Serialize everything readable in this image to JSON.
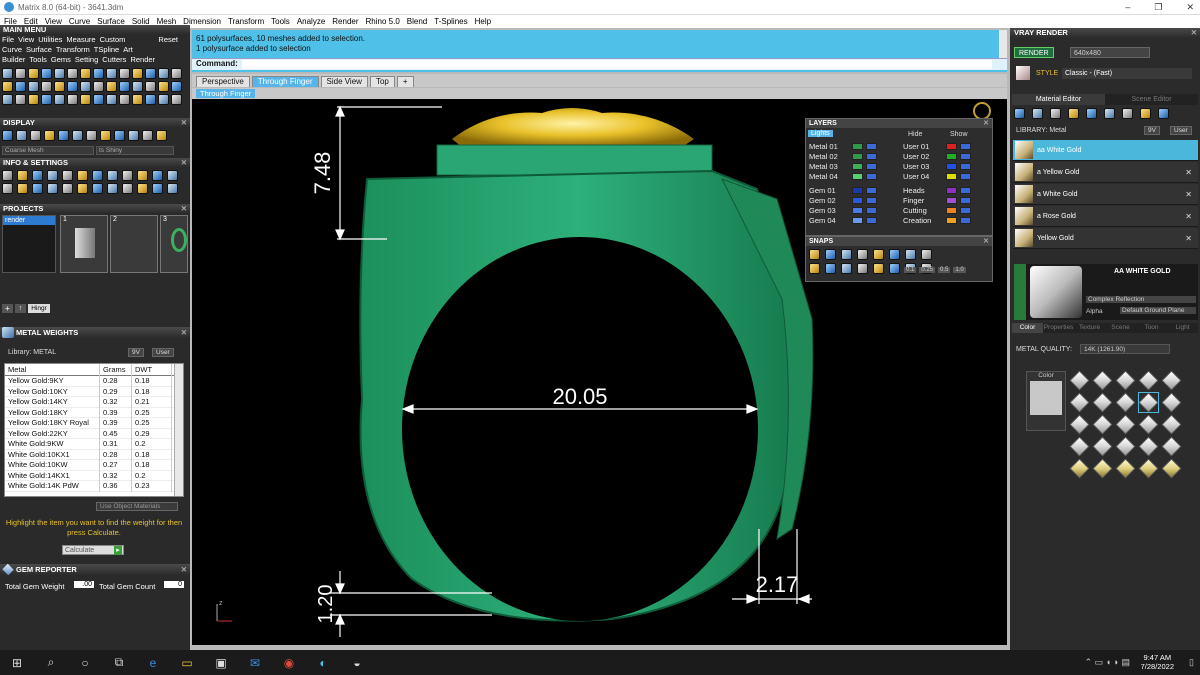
{
  "window": {
    "title": "Matrix 8.0 (64-bit) - 3641.3dm",
    "controls": [
      "–",
      "❐",
      "✕"
    ]
  },
  "menu": [
    "File",
    "Edit",
    "View",
    "Curve",
    "Surface",
    "Solid",
    "Mesh",
    "Dimension",
    "Transform",
    "Tools",
    "Analyze",
    "Render",
    "Rhino 5.0",
    "Blend",
    "T-Splines",
    "Help"
  ],
  "left": {
    "main_menu_title": "MAIN MENU",
    "main_menu_row1": [
      "File",
      "View",
      "Utilities",
      "Measure",
      "Custom"
    ],
    "reset": "Reset",
    "main_menu_row2": [
      "Curve",
      "Surface",
      "Transform",
      "TSpline",
      "Art"
    ],
    "main_menu_row3": [
      "Builder",
      "Tools",
      "Gems",
      "Setting",
      "Cutters",
      "Render"
    ],
    "display_title": "DISPLAY",
    "display_mesh": "Coarse Mesh",
    "display_shiny": "ts Shiny",
    "info_title": "INFO & SETTINGS",
    "projects_title": "PROJECTS",
    "projects_name": "render",
    "thumb_nums": [
      "1",
      "2",
      "3"
    ],
    "hinge": "Hingr",
    "metal_title": "METAL WEIGHTS",
    "library_label": "Library: METAL",
    "lib_opts": [
      "9V",
      "User"
    ],
    "table_headers": [
      "Metal",
      "Grams",
      "DWT"
    ],
    "metals": [
      [
        "Yellow Gold:9KY",
        "0.28",
        "0.18"
      ],
      [
        "Yellow Gold:10KY",
        "0.29",
        "0.18"
      ],
      [
        "Yellow Gold:14KY",
        "0.32",
        "0.21"
      ],
      [
        "Yellow Gold:18KY",
        "0.39",
        "0.25"
      ],
      [
        "Yellow Gold:18KY Royal",
        "0.39",
        "0.25"
      ],
      [
        "Yellow Gold:22KY",
        "0.45",
        "0.29"
      ],
      [
        "White Gold:9KW",
        "0.31",
        "0.2"
      ],
      [
        "White Gold:10KX1",
        "0.28",
        "0.18"
      ],
      [
        "White Gold:10KW",
        "0.27",
        "0.18"
      ],
      [
        "White Gold:14KX1",
        "0.32",
        "0.2"
      ],
      [
        "White Gold:14K PdW",
        "0.36",
        "0.23"
      ]
    ],
    "use_object_materials": "Use Object Materials",
    "hint": "Highlight the item you want to find the weight for then press Calculate.",
    "calculate": "Calculate",
    "gem_title": "GEM REPORTER",
    "gem_weight_label": "Total Gem Weight",
    "gem_weight_value": ".00",
    "gem_count_label": "Total Gem Count",
    "gem_count_value": "0"
  },
  "command": {
    "line1": "61 polysurfaces, 10 meshes added to selection.",
    "line2": "1 polysurface added to selection",
    "prompt": "Command:"
  },
  "viewport": {
    "tabs": [
      "Perspective",
      "Through Finger",
      "Side View",
      "Top"
    ],
    "active_tab": "Through Finger",
    "view_name": "Through Finger",
    "dim_top": "7.48",
    "dim_width": "20.05",
    "dim_side": "2.17",
    "dim_bottom": "1.20",
    "axis_z": "z"
  },
  "layers": {
    "title": "LAYERS",
    "lights": "Lights",
    "hide": "Hide",
    "show": "Show",
    "left_names": [
      "Metal 01",
      "Metal 02",
      "Metal 03",
      "Metal 04",
      "Gem 01",
      "Gem 02",
      "Gem 03",
      "Gem 04"
    ],
    "left_colors": [
      "#2e9a4a",
      "#2e9a4a",
      "#3bb05a",
      "#58d070",
      "#1a3aa8",
      "#2a5ad8",
      "#4a7ae8",
      "#6a9af0"
    ],
    "right_names": [
      "User 01",
      "User 02",
      "User 03",
      "User 04",
      "Heads",
      "Finger",
      "Cutting",
      "Creation"
    ],
    "right_colors": [
      "#e02020",
      "#20b020",
      "#2050e8",
      "#e0e000",
      "#9030c0",
      "#a050d0",
      "#f08020",
      "#f0a020"
    ]
  },
  "snaps": {
    "title": "SNAPS",
    "vals": [
      "0.1",
      "0.25",
      "0.5",
      "1.0"
    ]
  },
  "right": {
    "vray_title": "VRAY RENDER",
    "render_btn": "RENDER",
    "resolution": "640x480",
    "style_label": "STYLE",
    "style_value": "Classic - (Fast)",
    "tab_material": "Material Editor",
    "tab_scene": "Scene Editor",
    "library_label": "LIBRARY: Metal",
    "lib_opts": [
      "9V",
      "User"
    ],
    "materials": [
      "aa White Gold",
      "a Yellow Gold",
      "a White Gold",
      "a Rose Gold",
      "Yellow Gold"
    ],
    "selected_title": "AA WHITE GOLD",
    "complex": "Complex Reflection",
    "alpha": "Alpha",
    "ground": "Default Ground Plane",
    "subtabs": [
      "Color",
      "Properties",
      "Texture",
      "Scene",
      "Toon",
      "Light"
    ],
    "metal_quality_label": "METAL QUALITY:",
    "metal_quality_value": "14K (1261.90)",
    "color_label": "Color"
  },
  "taskbar": {
    "time": "9:47 AM",
    "date": "7/28/2022"
  }
}
